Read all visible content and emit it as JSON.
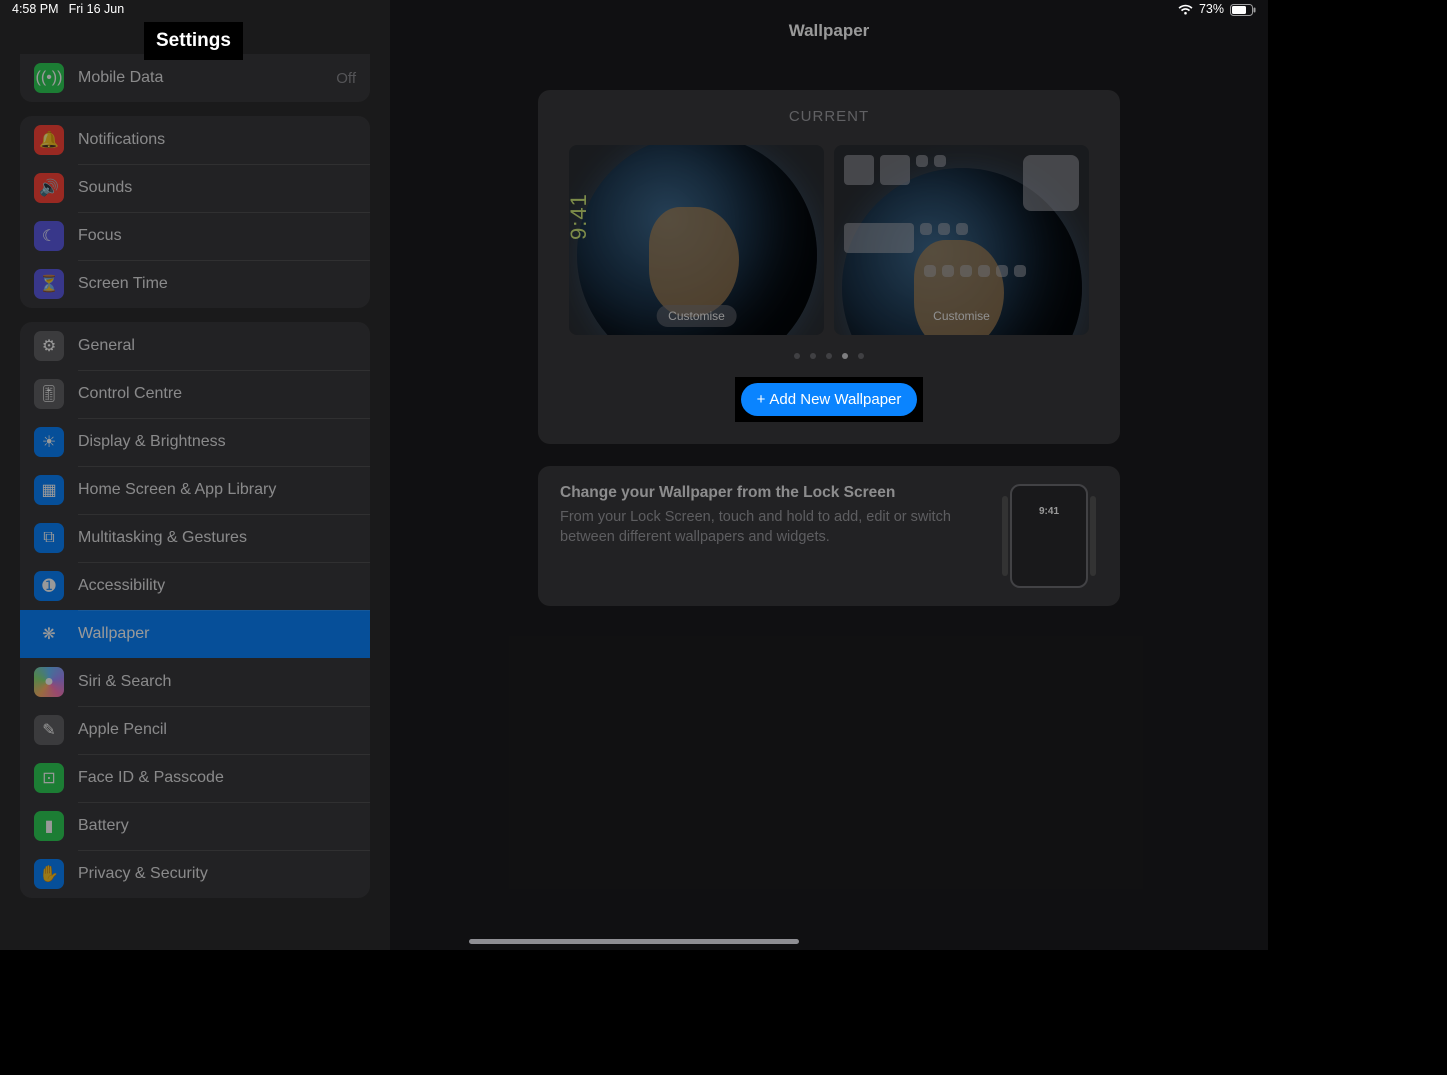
{
  "status": {
    "time": "4:58 PM",
    "date": "Fri 16 Jun",
    "battery_pct": "73%"
  },
  "sidebar": {
    "title": "Settings",
    "top_partial": {
      "label": "Mobile Data",
      "value": "Off"
    },
    "group_notifications": [
      {
        "icon": "bell-icon",
        "color": "c-red",
        "label": "Notifications"
      },
      {
        "icon": "speaker-icon",
        "color": "c-red",
        "label": "Sounds"
      },
      {
        "icon": "moon-icon",
        "color": "c-indigo",
        "label": "Focus"
      },
      {
        "icon": "timer-icon",
        "color": "c-indigo",
        "label": "Screen Time"
      }
    ],
    "group_general": [
      {
        "icon": "gear-icon",
        "color": "c-gray",
        "label": "General"
      },
      {
        "icon": "switches-icon",
        "color": "c-gray",
        "label": "Control Centre"
      },
      {
        "icon": "sun-icon",
        "color": "c-blue",
        "label": "Display & Brightness"
      },
      {
        "icon": "grid-icon",
        "color": "c-blue",
        "label": "Home Screen & App Library"
      },
      {
        "icon": "multitask-icon",
        "color": "c-blue",
        "label": "Multitasking & Gestures"
      },
      {
        "icon": "accessibility-icon",
        "color": "c-blue",
        "label": "Accessibility"
      },
      {
        "icon": "flower-icon",
        "color": "c-blue",
        "label": "Wallpaper",
        "selected": true
      },
      {
        "icon": "siri-icon",
        "color": "c-rainbow",
        "label": "Siri & Search"
      },
      {
        "icon": "pencil-icon",
        "color": "c-gray",
        "label": "Apple Pencil"
      },
      {
        "icon": "faceid-icon",
        "color": "c-green",
        "label": "Face ID & Passcode"
      },
      {
        "icon": "battery-icon",
        "color": "c-green",
        "label": "Battery"
      },
      {
        "icon": "hand-icon",
        "color": "c-blue",
        "label": "Privacy & Security"
      }
    ]
  },
  "detail": {
    "title": "Wallpaper",
    "current_label": "CURRENT",
    "lock_preview_time": "9:41",
    "customise_label": "Customise",
    "page_dots": {
      "count": 5,
      "active_index": 3
    },
    "add_button": "Add New Wallpaper",
    "info": {
      "heading": "Change your Wallpaper from the Lock Screen",
      "body": "From your Lock Screen, touch and hold to add, edit or switch between different wallpapers and widgets.",
      "mini_time": "9:41"
    }
  }
}
